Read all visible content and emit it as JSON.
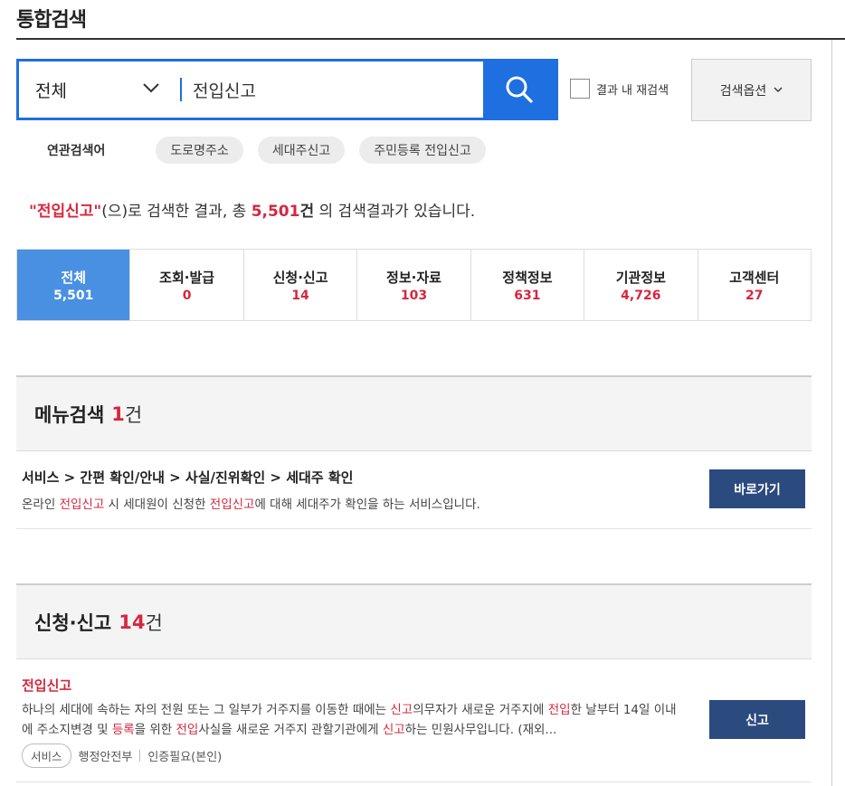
{
  "page": {
    "title": "통합검색"
  },
  "search": {
    "scope": "전체",
    "query": "전입신고",
    "refine_label": "결과 내 재검색",
    "options_label": "검색옵션"
  },
  "related": {
    "label": "연관검색어",
    "chips": [
      "도로명주소",
      "세대주신고",
      "주민등록 전입신고"
    ]
  },
  "summary": {
    "open_quote": "\"",
    "keyword": "전입신고",
    "close_quote": "\"",
    "text1": "(으)로 검색한 결과, 총 ",
    "count": "5,501",
    "unit": "건",
    "text2": " 의 검색결과가 있습니다."
  },
  "tabs": [
    {
      "label": "전체",
      "count": "5,501"
    },
    {
      "label": "조회·발급",
      "count": "0"
    },
    {
      "label": "신청·신고",
      "count": "14"
    },
    {
      "label": "정보·자료",
      "count": "103"
    },
    {
      "label": "정책정보",
      "count": "631"
    },
    {
      "label": "기관정보",
      "count": "4,726"
    },
    {
      "label": "고객센터",
      "count": "27"
    }
  ],
  "menu_section": {
    "title": "메뉴검색",
    "count": "1",
    "unit": "건",
    "item": {
      "path": "서비스 > 간편 확인/안내 > 사실/진위확인 > 세대주 확인",
      "desc_parts": [
        "온라인 ",
        "전입신고",
        " 시 세대원이 신청한 ",
        "전입신고",
        "에 대해 세대주가 확인을 하는 서비스입니다."
      ],
      "button": "바로가기"
    }
  },
  "apply_section": {
    "title": "신청·신고",
    "count": "14",
    "unit": "건",
    "item": {
      "title": "전입신고",
      "desc_parts": [
        "하나의 세대에 속하는 자의 전원 또는 그 일부가 거주지를 이동한 때에는 ",
        "신고",
        "의무자가 새로운 거주지에 ",
        "전입",
        "한 날부터 14일 이내에 주소지변경 및 ",
        "등록",
        "을 위한 ",
        "전입",
        "사실을 새로운 거주지 관할기관에게 ",
        "신고",
        "하는 민원사무입니다. (재외..."
      ],
      "tag": "서비스",
      "org": "행정안전부",
      "auth": "인증필요(본인)",
      "button": "신고"
    }
  },
  "colors": {
    "accent": "#1e6fe0",
    "highlight": "#d7263d",
    "dark_button": "#2b4a7e",
    "active_tab": "#4a90e2"
  }
}
